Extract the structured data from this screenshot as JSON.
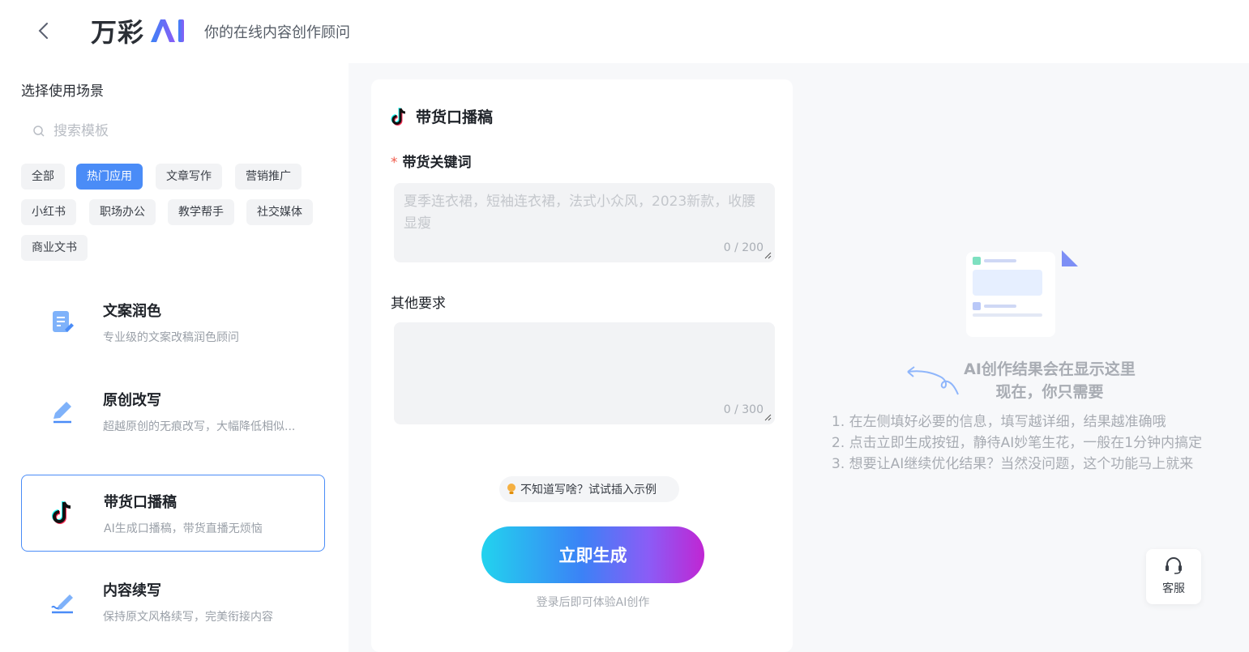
{
  "header": {
    "logo_text": "万彩",
    "logo_ai": "AI",
    "slogan": "你的在线内容创作顾问"
  },
  "sidebar": {
    "section_title": "选择使用场景",
    "search_placeholder": "搜索模板",
    "tags": [
      {
        "label": "全部",
        "active": false
      },
      {
        "label": "热门应用",
        "active": true
      },
      {
        "label": "文章写作",
        "active": false
      },
      {
        "label": "营销推广",
        "active": false
      },
      {
        "label": "小红书",
        "active": false
      },
      {
        "label": "职场办公",
        "active": false
      },
      {
        "label": "教学帮手",
        "active": false
      },
      {
        "label": "社交媒体",
        "active": false
      },
      {
        "label": "商业文书",
        "active": false
      }
    ],
    "cards": [
      {
        "title": "文案润色",
        "desc": "专业级的文案改稿润色顾问",
        "icon": "document-edit-icon",
        "active": false
      },
      {
        "title": "原创改写",
        "desc": "超越原创的无痕改写，大幅降低相似...",
        "icon": "pencil-icon",
        "active": false
      },
      {
        "title": "带货口播稿",
        "desc": "AI生成口播稿，带货直播无烦恼",
        "icon": "tiktok-icon",
        "active": true
      },
      {
        "title": "内容续写",
        "desc": "保持原文风格续写，完美衔接内容",
        "icon": "pen-write-icon",
        "active": false
      }
    ]
  },
  "form": {
    "title": "带货口播稿",
    "title_icon": "tiktok-icon",
    "keyword_label": "带货关键词",
    "required_mark": "*",
    "keyword_placeholder": "夏季连衣裙，短袖连衣裙，法式小众风，2023新款，收腰显瘦",
    "keyword_counter": "0 / 200",
    "other_label": "其他要求",
    "other_placeholder": "",
    "other_counter": "0 / 300",
    "hint_text": "不知道写啥？试试插入示例",
    "generate_label": "立即生成",
    "login_tip": "登录后即可体验AI创作"
  },
  "result": {
    "title_line1": "AI创作结果会在显示这里",
    "title_line2": "现在，你只需要",
    "steps": [
      "1. 在左侧填好必要的信息，填写越详细，结果越准确哦",
      "2. 点击立即生成按钮，静待AI妙笔生花，一般在1分钟内搞定",
      "3. 想要让AI继续优化结果？当然没问题，这个功能马上就来"
    ]
  },
  "service": {
    "label": "客服",
    "icon": "headset-icon"
  },
  "colors": {
    "accent": "#4a8cf7",
    "required": "#f05a4a",
    "gradient_start": "#22d3ee",
    "gradient_end": "#c026d3"
  }
}
